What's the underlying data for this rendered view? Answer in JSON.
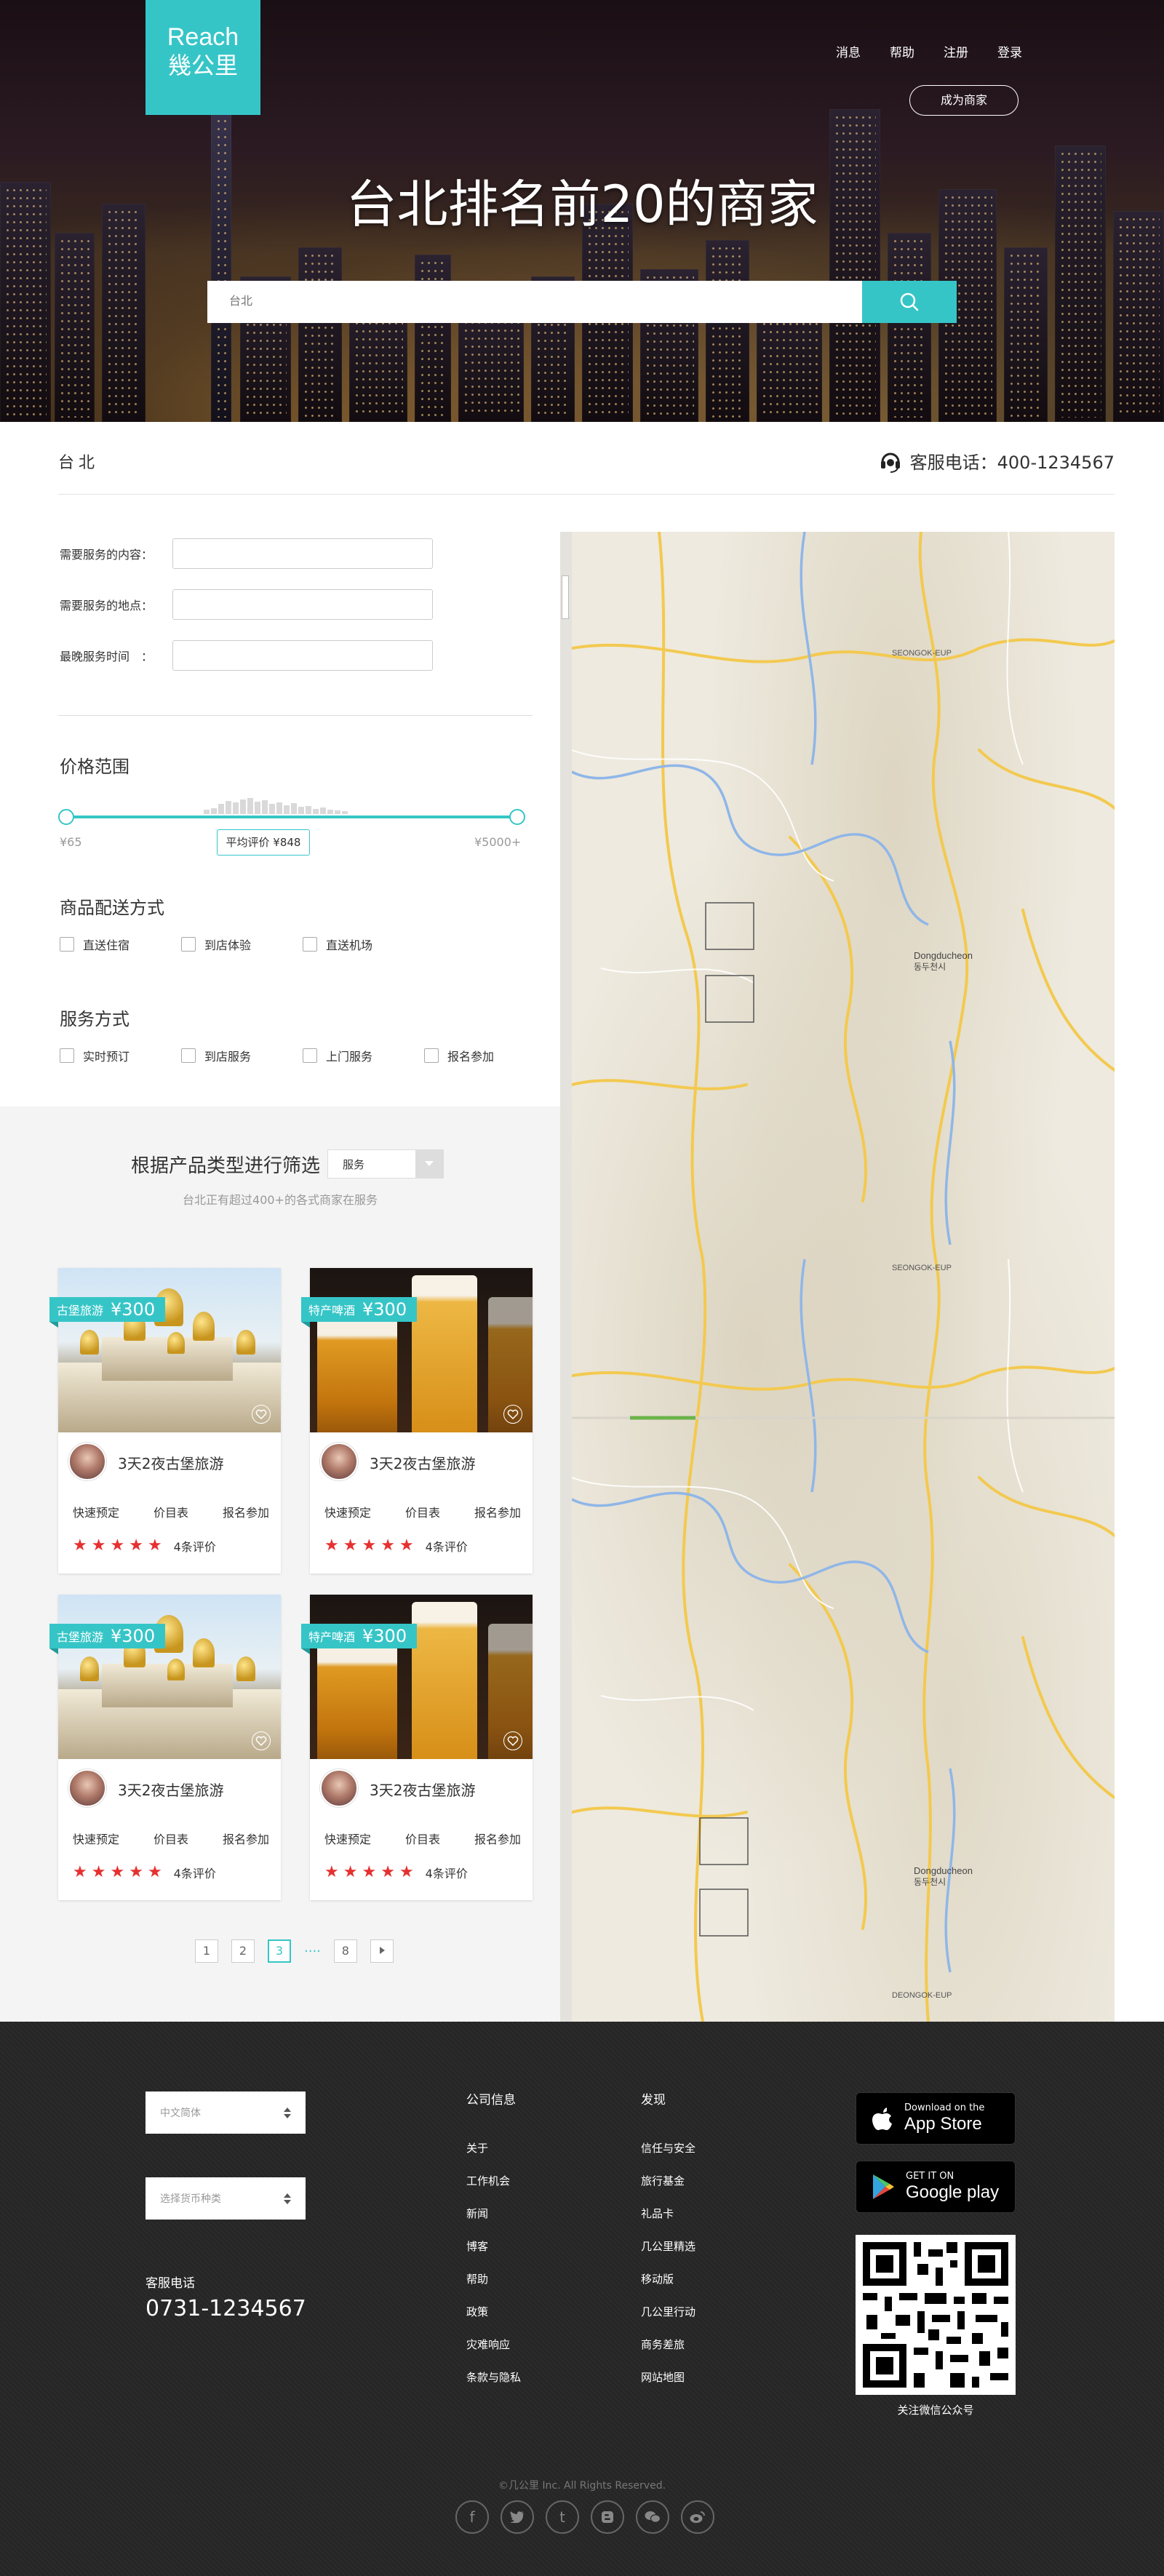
{
  "hero": {
    "logo_en": "Reach",
    "logo_cn": "幾公里",
    "nav": [
      "消息",
      "帮助",
      "注册",
      "登录"
    ],
    "merchant_button": "成为商家",
    "title": "台北排名前20的商家",
    "search_placeholder": "台北",
    "search_icon": "search-icon"
  },
  "city_bar": {
    "city": "台北",
    "hotline": "客服电话：400-1234567",
    "hotline_icon": "headset-icon"
  },
  "filters": {
    "fields": [
      {
        "label": "需要服务的内容：",
        "value": ""
      },
      {
        "label": "需要服务的地点：",
        "value": ""
      },
      {
        "label": "最晚服务时间　：",
        "value": ""
      }
    ],
    "price": {
      "title": "价格范围",
      "min": "¥65",
      "max": "¥5000+",
      "avg_label": "平均评价 ¥848"
    },
    "delivery": {
      "title": "商品配送方式",
      "options": [
        "直送住宿",
        "到店体验",
        "直送机场"
      ]
    },
    "service": {
      "title": "服务方式",
      "options": [
        "实时预订",
        "到店服务",
        "上门服务",
        "报名参加"
      ]
    }
  },
  "results": {
    "type_label": "根据产品类型进行筛选",
    "type_value": "服务",
    "subtitle": "台北正有超过400+的各式商家在服务",
    "cards": [
      {
        "tag": "古堡旅游",
        "price": "¥300",
        "title": "3天2夜古堡旅游",
        "actions": [
          "快速预定",
          "价目表",
          "报名参加"
        ],
        "rating": 5,
        "reviews": "4条评价",
        "image": "church"
      },
      {
        "tag": "特产啤酒",
        "price": "¥300",
        "title": "3天2夜古堡旅游",
        "actions": [
          "快速预定",
          "价目表",
          "报名参加"
        ],
        "rating": 5,
        "reviews": "4条评价",
        "image": "beer"
      },
      {
        "tag": "古堡旅游",
        "price": "¥300",
        "title": "3天2夜古堡旅游",
        "actions": [
          "快速预定",
          "价目表",
          "报名参加"
        ],
        "rating": 5,
        "reviews": "4条评价",
        "image": "church"
      },
      {
        "tag": "特产啤酒",
        "price": "¥300",
        "title": "3天2夜古堡旅游",
        "actions": [
          "快速预定",
          "价目表",
          "报名参加"
        ],
        "rating": 5,
        "reviews": "4条评价",
        "image": "beer"
      }
    ],
    "pagination": {
      "pages": [
        "1",
        "2",
        "3",
        "····",
        "8"
      ],
      "current": "3",
      "next_icon": "next-arrow-icon"
    }
  },
  "map": {
    "labels": [
      "Dongducheon",
      "동두천시",
      "DEONGOK-EUP",
      "SEONGOK-EUP"
    ]
  },
  "footer": {
    "language": "中文简体",
    "currency": "选择货币种类",
    "service_label": "客服电话",
    "phone": "0731-1234567",
    "col1": {
      "title": "公司信息",
      "items": [
        "关于",
        "工作机会",
        "新闻",
        "博客",
        "帮助",
        "政策",
        "灾难响应",
        "条款与隐私"
      ]
    },
    "col2": {
      "title": "发现",
      "items": [
        "信任与安全",
        "旅行基金",
        "礼品卡",
        "几公里精选",
        "移动版",
        "几公里行动",
        "商务差旅",
        "网站地图"
      ]
    },
    "appstore": {
      "line1": "Download on the",
      "line2": "App Store"
    },
    "googleplay": {
      "line1": "GET IT ON",
      "line2": "Google play"
    },
    "qr_caption": "关注微信公众号",
    "copyright": "©几公里 Inc. All Rights Reserved.",
    "socials": [
      "facebook-icon",
      "twitter-icon",
      "tumblr-icon",
      "blogger-icon",
      "wechat-icon",
      "weibo-icon"
    ]
  },
  "colors": {
    "accent": "#36c5c7",
    "star": "#e63030",
    "footer_bg": "#262626"
  }
}
